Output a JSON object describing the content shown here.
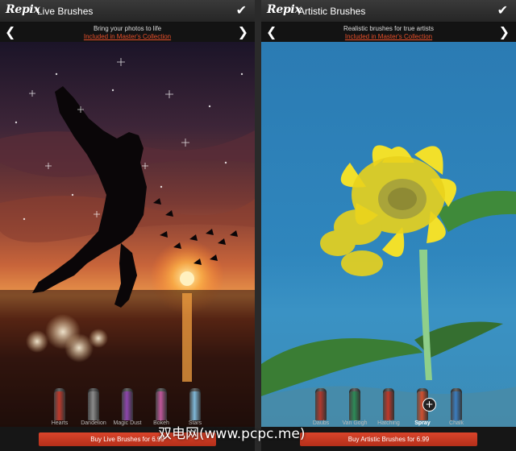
{
  "left_screen": {
    "logo": "Repix",
    "title": "Live Brushes",
    "tagline": "Bring your photos to life",
    "collection_link": "Included in Master's Collection",
    "brushes": [
      {
        "label": "Hearts",
        "color": "#c0392b"
      },
      {
        "label": "Dandelion",
        "color": "#8a8a8a"
      },
      {
        "label": "Magic Dust",
        "color": "#8e44ad"
      },
      {
        "label": "Bokeh",
        "color": "#c0569a"
      },
      {
        "label": "Stars",
        "color": "#7fb8d8"
      }
    ],
    "buy_label": "Buy Live Brushes for 6.99"
  },
  "right_screen": {
    "logo": "Repix",
    "title": "Artistic Brushes",
    "tagline": "Realistic brushes for true artists",
    "collection_link": "Included in Master's Collection",
    "brushes": [
      {
        "label": "Daubs",
        "color": "#b03a2e"
      },
      {
        "label": "Van Gogh",
        "color": "#2e8b57"
      },
      {
        "label": "Hatching",
        "color": "#c0392b"
      },
      {
        "label": "Spray",
        "color": "#d05030"
      },
      {
        "label": "Chalk",
        "color": "#3b7dbf"
      }
    ],
    "buy_label": "Buy Artistic Brushes for 6.99"
  },
  "watermark": "双电网(www.pcpc.me)",
  "accent_color": "#d23c25"
}
